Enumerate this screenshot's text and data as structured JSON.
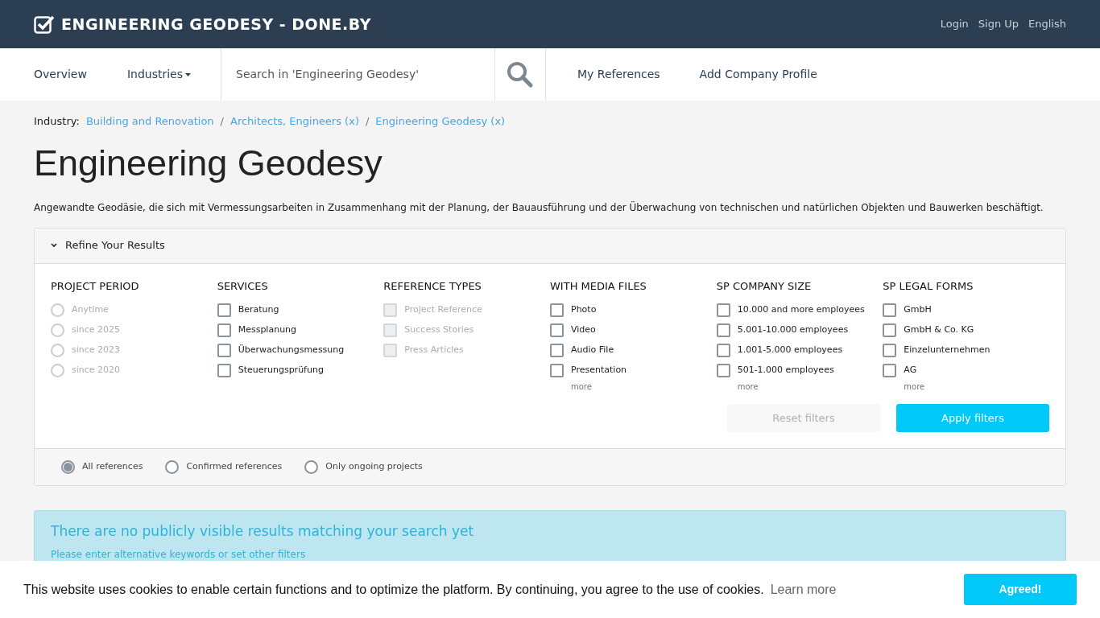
{
  "header": {
    "logo": "ENGINEERING GEODESY - DONE.BY",
    "links": [
      "Login",
      "Sign Up",
      "English"
    ]
  },
  "nav": {
    "items": [
      {
        "label": "Overview",
        "dropdown": false
      },
      {
        "label": "Industries",
        "dropdown": true
      }
    ],
    "search": {
      "placeholder": "Search in 'Engineering Geodesy'"
    },
    "links": [
      "My References",
      "Add Company Profile"
    ]
  },
  "breadcrumb": {
    "label": "Industry:",
    "items": [
      "Building and Renovation",
      "Architects, Engineers (x)",
      "Engineering Geodesy (x)"
    ],
    "separator": "/"
  },
  "title": "Engineering Geodesy",
  "description": "Angewandte Geodäsie, die sich mit Vermessungsarbeiten in Zusammenhang mit der Planung, der Bauausführung und der Überwachung von technischen und natürlichen Objekten und Bauwerken beschäftigt.",
  "filters": {
    "title": "Refine Your Results",
    "expanded": true,
    "groups": [
      {
        "title": "PROJECT PERIOD",
        "kind": "radio",
        "options": [
          {
            "label": "Anytime",
            "checked": false,
            "disabled": true
          },
          {
            "label": "since 2025",
            "checked": false,
            "disabled": true
          },
          {
            "label": "since 2023",
            "checked": false,
            "disabled": true
          },
          {
            "label": "since 2020",
            "checked": false,
            "disabled": true
          }
        ]
      },
      {
        "title": "SERVICES",
        "kind": "checkbox",
        "options": [
          {
            "label": "Beratung",
            "checked": false,
            "disabled": false
          },
          {
            "label": "Messplanung",
            "checked": false,
            "disabled": false
          },
          {
            "label": "Überwachungsmessung",
            "checked": false,
            "disabled": false
          },
          {
            "label": "Steuerungsprüfung",
            "checked": false,
            "disabled": false
          }
        ]
      },
      {
        "title": "REFERENCE TYPES",
        "kind": "checkbox",
        "options": [
          {
            "label": "Project Reference",
            "checked": false,
            "disabled": true
          },
          {
            "label": "Success Stories",
            "checked": false,
            "disabled": true
          },
          {
            "label": "Press Articles",
            "checked": false,
            "disabled": true
          }
        ]
      },
      {
        "title": "WITH MEDIA FILES",
        "kind": "checkbox",
        "options": [
          {
            "label": "Photo",
            "checked": false,
            "disabled": false
          },
          {
            "label": "Video",
            "checked": false,
            "disabled": false
          },
          {
            "label": "Audio File",
            "checked": false,
            "disabled": false
          },
          {
            "label": "Presentation",
            "checked": false,
            "disabled": false
          }
        ],
        "more": "more"
      },
      {
        "title": "SP COMPANY SIZE",
        "kind": "checkbox",
        "options": [
          {
            "label": "10.000 and more employees",
            "checked": false,
            "disabled": false
          },
          {
            "label": "5.001-10.000 employees",
            "checked": false,
            "disabled": false
          },
          {
            "label": "1.001-5.000 employees",
            "checked": false,
            "disabled": false
          },
          {
            "label": "501-1.000 employees",
            "checked": false,
            "disabled": false
          }
        ],
        "more": "more"
      },
      {
        "title": "SP LEGAL FORMS",
        "kind": "checkbox",
        "options": [
          {
            "label": "GmbH",
            "checked": false,
            "disabled": false
          },
          {
            "label": "GmbH & Co. KG",
            "checked": false,
            "disabled": false
          },
          {
            "label": "Einzelunternehmen",
            "checked": false,
            "disabled": false
          },
          {
            "label": "AG",
            "checked": false,
            "disabled": false
          }
        ],
        "more": "more"
      }
    ],
    "reset": {
      "label": "Reset filters",
      "disabled": true
    },
    "apply": {
      "label": "Apply filters"
    },
    "scope": [
      {
        "label": "All references",
        "selected": true
      },
      {
        "label": "Confirmed references",
        "selected": false
      },
      {
        "label": "Only ongoing projects",
        "selected": false
      }
    ]
  },
  "alert": {
    "title": "There are no publicly visible results matching your search yet",
    "text": "Please enter alternative keywords or set other filters"
  },
  "cookie": {
    "text": "This website uses cookies to enable certain functions and to optimize the platform. By continuing, you agree to the use of cookies.",
    "link": "Learn more",
    "button": "Agreed!"
  }
}
